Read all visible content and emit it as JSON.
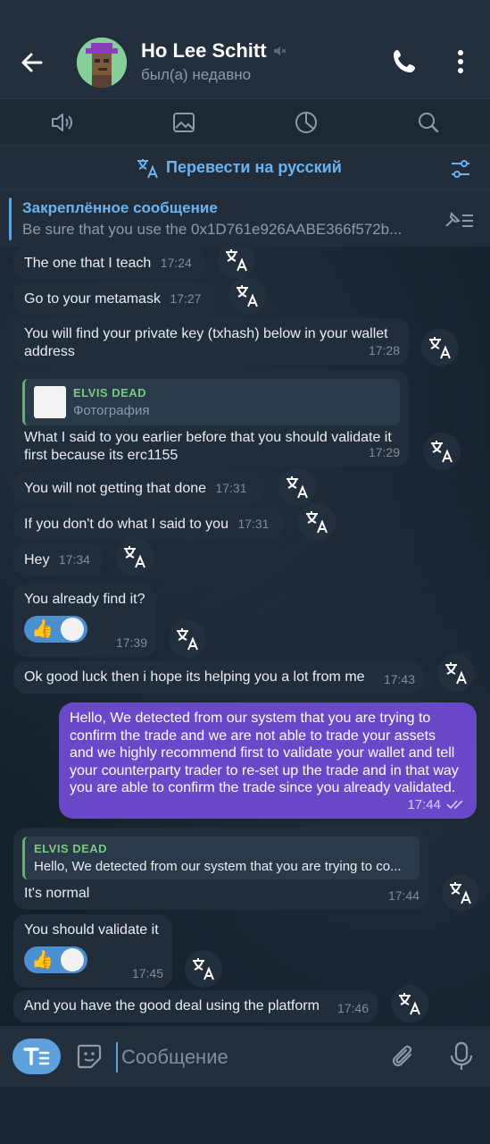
{
  "header": {
    "contact_name": "Ho Lee Schitt",
    "status": "был(а) недавно"
  },
  "translate_bar": {
    "label": "Перевести на русский"
  },
  "pinned": {
    "title": "Закреплённое сообщение",
    "text": "Be sure that you use the 0x1D761e926AABE366f572b..."
  },
  "messages": [
    {
      "text": "The one that I teach",
      "time": "17:24"
    },
    {
      "text": "Go to your metamask",
      "time": "17:27"
    },
    {
      "text_line1": "You will find your private key (txhash) below in your wallet",
      "text_line2": "address",
      "time": "17:28"
    },
    {
      "reply_name": "ELVIS DEAD",
      "reply_sub": "Фотография",
      "text_line1": "What I said to you earlier before that you should validate it",
      "text_line2": "first because its erc1155",
      "time": "17:29"
    },
    {
      "text": "You will not getting that done",
      "time": "17:31"
    },
    {
      "text": "If you don't do what I said to you",
      "time": "17:31"
    },
    {
      "text": "Hey",
      "time": "17:34"
    },
    {
      "text": "You already find it?",
      "time": "17:39",
      "reaction": "👍"
    },
    {
      "text": "Ok good luck then i hope its helping you a lot from me",
      "time": "17:43"
    },
    {
      "outgoing": true,
      "lines": [
        "Hello, We detected from our system that you are trying to",
        "confirm the trade and we are not able to trade your assets",
        "and we highly recommend first to validate your wallet and tell",
        "your counterparty trader to re-set up the trade and in that way",
        "you are able to confirm the trade since you already validated."
      ],
      "time": "17:44"
    },
    {
      "reply_name": "ELVIS DEAD",
      "reply_sub": "Hello, We detected from our system that you are trying to co...",
      "text": "It's normal",
      "time": "17:44"
    },
    {
      "text": "You should validate it",
      "time": "17:45",
      "reaction": "👍"
    },
    {
      "text": "And you have the good deal using the platform",
      "time": "17:46"
    }
  ],
  "composer": {
    "placeholder": "Сообщение"
  },
  "colors": {
    "accent": "#6ab3f3",
    "outgoing_bubble": "#6a49c8",
    "incoming_bubble": "#212d3b",
    "reply_name": "#79c97d"
  }
}
